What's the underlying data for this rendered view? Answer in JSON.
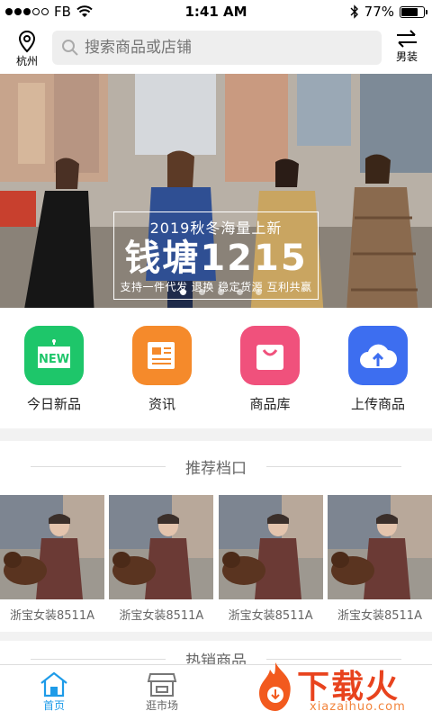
{
  "status": {
    "carrier": "FB",
    "time": "1:41 AM",
    "battery": "77%",
    "battery_level": 0.77
  },
  "header": {
    "location": "杭州",
    "search_placeholder": "搜索商品或店铺",
    "gender": "男装"
  },
  "banner": {
    "line1": "2019秋冬海量上新",
    "line2": "钱塘1215",
    "line3": "支持一件代发 退换 稳定货源 互利共赢"
  },
  "quick_links": [
    {
      "label": "今日新品",
      "icon": "new-tag-icon",
      "color": "#1ec66a"
    },
    {
      "label": "资讯",
      "icon": "newspaper-icon",
      "color": "#f58a2b"
    },
    {
      "label": "商品库",
      "icon": "shopping-bag-icon",
      "color": "#f0517c"
    },
    {
      "label": "上传商品",
      "icon": "cloud-upload-icon",
      "color": "#3d6ef0"
    }
  ],
  "recommended": {
    "title": "推荐档口",
    "stalls": [
      {
        "name": "浙宝女装8511A"
      },
      {
        "name": "浙宝女装8511A"
      },
      {
        "name": "浙宝女装8511A"
      },
      {
        "name": "浙宝女装8511A"
      }
    ]
  },
  "hot": {
    "title": "热销商品"
  },
  "tabs": [
    {
      "label": "首页",
      "icon": "home-icon",
      "active": true
    },
    {
      "label": "逛市场",
      "icon": "market-icon",
      "active": false
    }
  ],
  "watermark": {
    "text": "下载火",
    "sub": "xiazaihuo.com"
  },
  "colors": {
    "accent": "#1e9be8",
    "watermark": "#e8431e"
  }
}
